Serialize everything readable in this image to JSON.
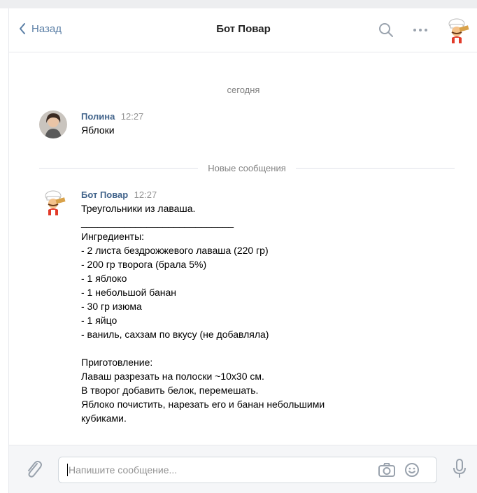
{
  "header": {
    "back_label": "Назад",
    "title": "Бот Повар"
  },
  "chat": {
    "date_label": "сегодня",
    "new_messages_label": "Новые сообщения",
    "messages": [
      {
        "author": "Полина",
        "time": "12:27",
        "text": "Яблоки"
      },
      {
        "author": "Бот Повар",
        "time": "12:27",
        "text": "Треугольники из лаваша.\n____________________________\nИнгредиенты:\n- 2 листа бездрожжевого лаваша (220 гр)\n- 200 гр творога (брала 5%)\n- 1 яблоко\n- 1 небольшой банан\n- 30 гр изюма\n- 1 яйцо\n- ваниль, сахзам по вкусу (не добавляла)\n\nПриготовление:\nЛаваш разрезать на полоски ~10х30 см.\nВ творог добавить белок, перемешать.\nЯблоко почистить, нарезать его и банан небольшими\nкубиками."
      }
    ]
  },
  "composer": {
    "placeholder": "Напишите сообщение..."
  },
  "colors": {
    "accent": "#5b7fa6",
    "author": "#42648b",
    "muted": "#828282"
  }
}
